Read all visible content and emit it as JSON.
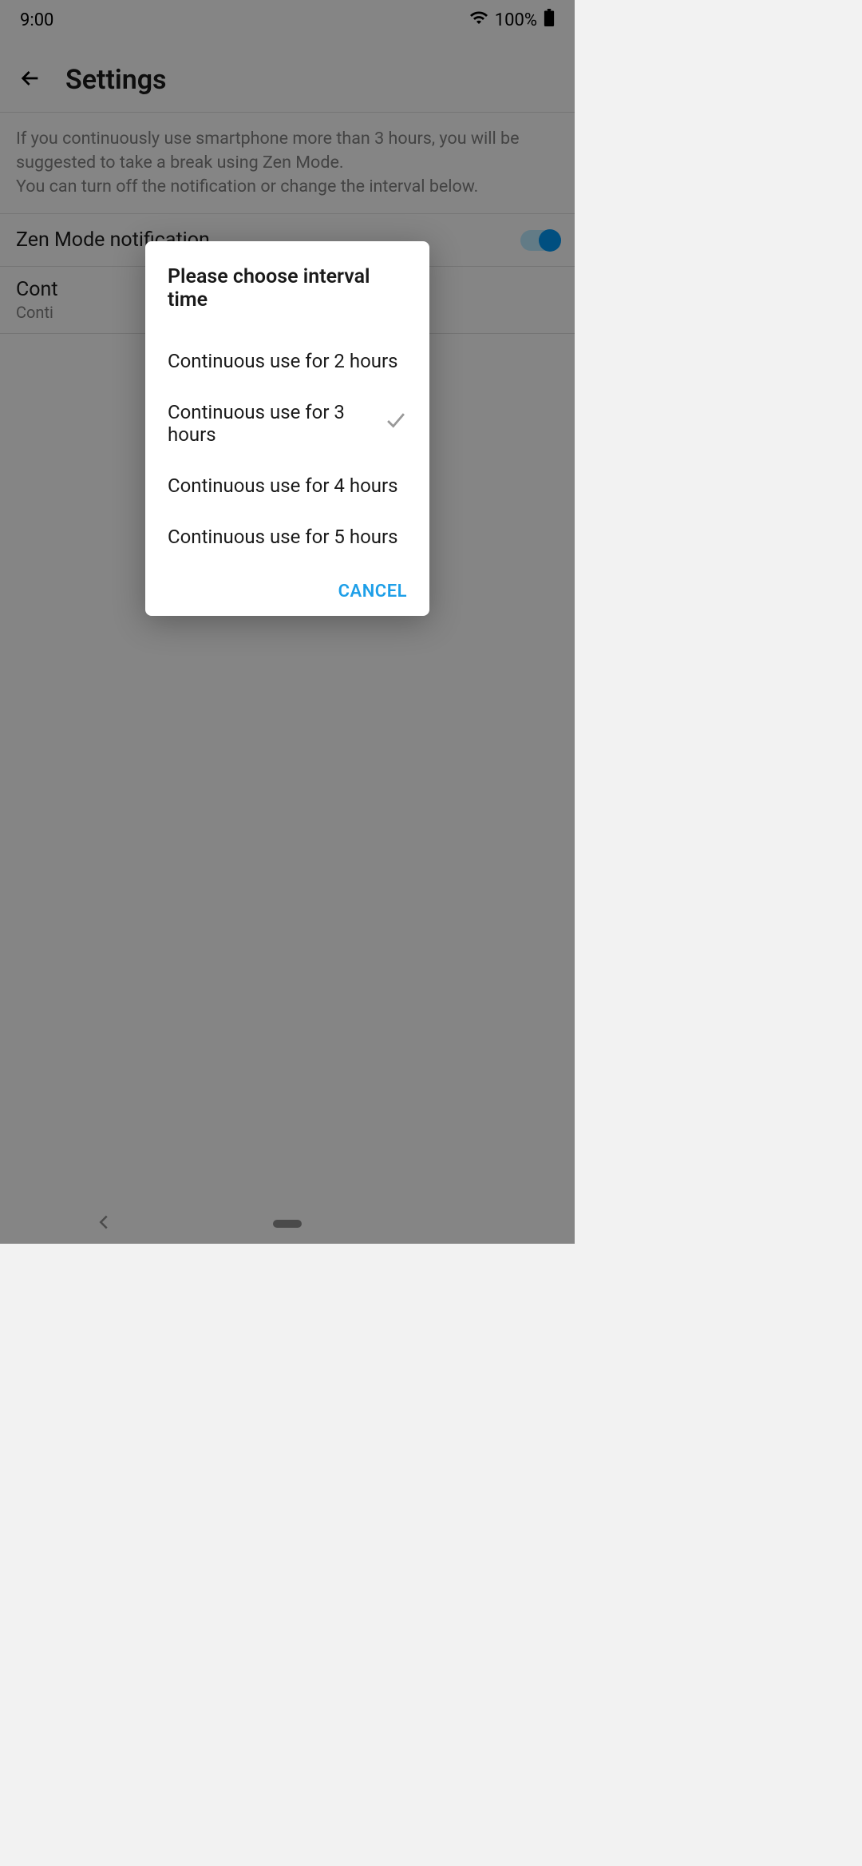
{
  "statusBar": {
    "time": "9:00",
    "battery": "100%"
  },
  "header": {
    "title": "Settings"
  },
  "description": "If you continuously use smartphone more than 3 hours, you will be suggested to take a break using Zen Mode.\nYou can turn off the notification or change the interval below.",
  "settings": {
    "notificationLabel": "Zen Mode notification",
    "intervalLabel": "Cont",
    "intervalValue": "Conti"
  },
  "dialog": {
    "title": "Please choose interval time",
    "options": [
      {
        "label": "Continuous use for 2 hours",
        "selected": false
      },
      {
        "label": "Continuous use for 3 hours",
        "selected": true
      },
      {
        "label": "Continuous use for 4 hours",
        "selected": false
      },
      {
        "label": "Continuous use for 5 hours",
        "selected": false
      }
    ],
    "cancelLabel": "CANCEL"
  }
}
